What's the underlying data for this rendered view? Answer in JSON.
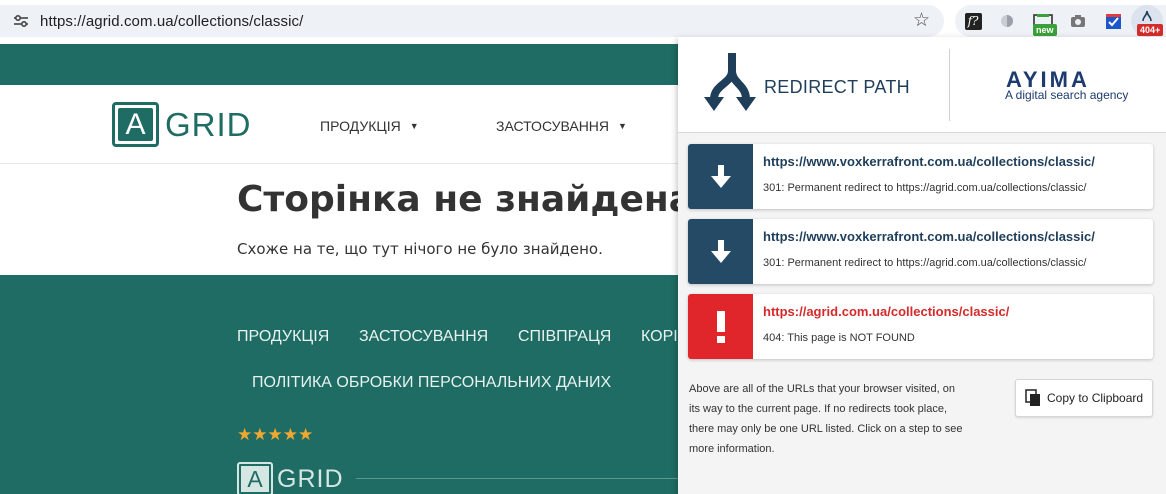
{
  "browser": {
    "url": "https://agrid.com.ua/collections/classic/",
    "extensions": [
      {
        "icon": "fx-extension-icon"
      },
      {
        "icon": "circle-extension-icon"
      },
      {
        "icon": "new-extension-icon",
        "badge": "new"
      },
      {
        "icon": "camera-extension-icon"
      },
      {
        "icon": "checkbox-extension-icon"
      },
      {
        "icon": "redirect-path-extension-icon",
        "badge": "404+"
      }
    ]
  },
  "site": {
    "logo_letter": "A",
    "logo_word": "GRID",
    "menu": [
      {
        "label": "ПРОДУКЦІЯ"
      },
      {
        "label": "ЗАСТОСУВАННЯ"
      }
    ],
    "not_found_title": "Сторінка не знайдена.",
    "not_found_subtitle": "Схоже на те, що тут нічого не було знайдено.",
    "footer_links": [
      {
        "label": "ПРОДУКЦІЯ"
      },
      {
        "label": "ЗАСТОСУВАННЯ"
      },
      {
        "label": "СПІВПРАЦЯ"
      },
      {
        "label": "КОРІ"
      },
      {
        "label": "ПОЛІТИКА ОБРОБКИ ПЕРСОНАЛЬНИХ ДАНИХ"
      }
    ],
    "rating_stars": "★★★★★",
    "star_color": "#f0a830",
    "brand_color": "#1e6c63"
  },
  "popup": {
    "title": "REDIRECT PATH",
    "brand": "AYIMA",
    "tagline": "A digital search agency",
    "steps": [
      {
        "type": "redirect",
        "url": "https://www.voxkerrafront.com.ua/collections/classic/",
        "description": "301: Permanent redirect to https://agrid.com.ua/collections/classic/"
      },
      {
        "type": "redirect",
        "url": "https://www.voxkerrafront.com.ua/collections/classic/",
        "description": "301: Permanent redirect to https://agrid.com.ua/collections/classic/"
      },
      {
        "type": "error",
        "url": "https://agrid.com.ua/collections/classic/",
        "description": "404: This page is NOT FOUND"
      }
    ],
    "note": "Above are all of the URLs that your browser visited, on its way to the current page. If no redirects took place, there may only be one URL listed. Click on a step to see more information.",
    "copy_label": "Copy to Clipboard",
    "redirect_color": "#244a66",
    "error_color": "#e1262b"
  }
}
